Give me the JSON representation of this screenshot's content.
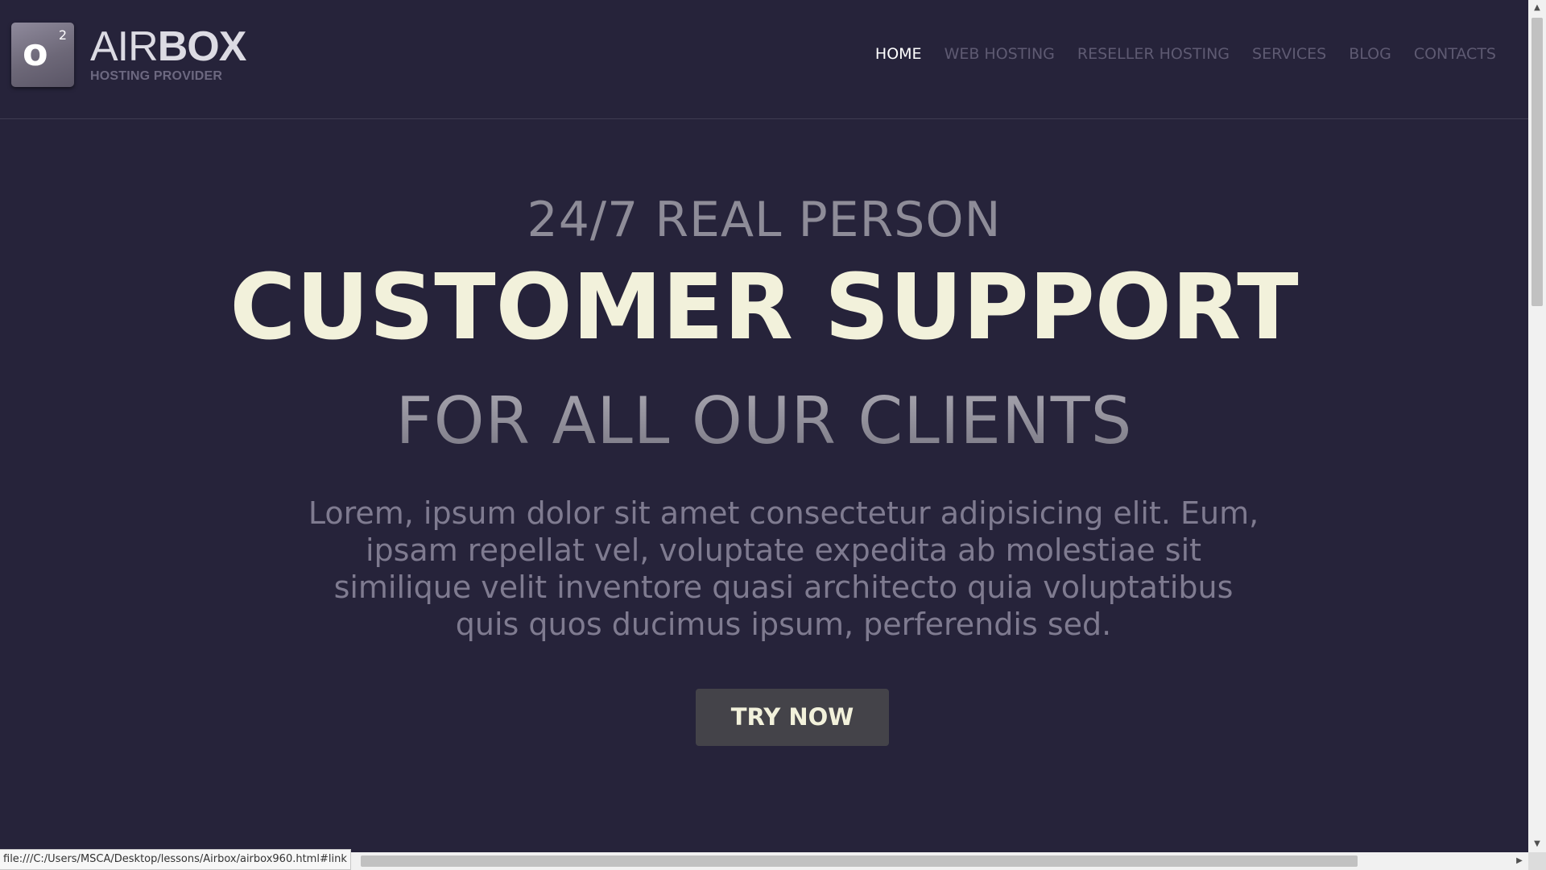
{
  "logo": {
    "badge_letter": "o",
    "badge_sup": "2",
    "title_light": "AIR",
    "title_bold": "BOX",
    "subtitle": "HOSTING PROVIDER"
  },
  "nav": {
    "items": [
      {
        "label": "HOME",
        "active": true
      },
      {
        "label": "WEB HOSTING",
        "active": false
      },
      {
        "label": "RESELLER HOSTING",
        "active": false
      },
      {
        "label": "SERVICES",
        "active": false
      },
      {
        "label": "BLOG",
        "active": false
      },
      {
        "label": "CONTACTS",
        "active": false
      }
    ]
  },
  "hero": {
    "line1": "24/7 REAL PERSON",
    "line2": "CUSTOMER SUPPORT",
    "line3": "FOR ALL OUR CLIENTS",
    "paragraph": "Lorem, ipsum dolor sit amet consectetur adipisicing elit. Eum, ipsam repellat vel, voluptate expedita ab molestiae sit similique velit inventore quasi architecto quia voluptatibus quis quos ducimus ipsum, perferendis sed.",
    "cta_label": "TRY NOW"
  },
  "browser": {
    "status_url": "file:///C:/Users/MSCA/Desktop/lessons/Airbox/airbox960.html#link",
    "scroll_up_icon": "▲",
    "scroll_down_icon": "▼",
    "scroll_right_icon": "▶"
  },
  "colors": {
    "background": "#26233a",
    "accent_light": "#f2f1db",
    "nav_inactive": "#5e5a72",
    "button_bg": "#444349"
  }
}
